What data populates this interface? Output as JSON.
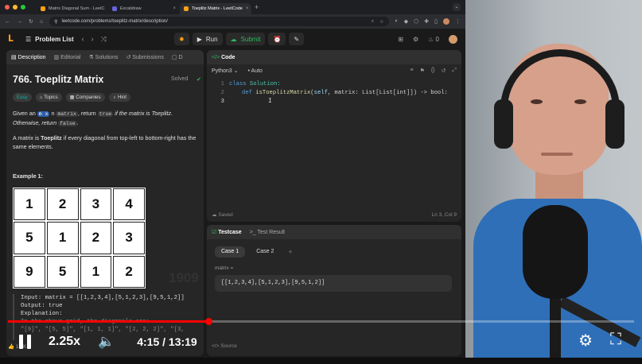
{
  "browser": {
    "tabs": [
      {
        "label": "Matrix Diagonal Sum - LeetC",
        "favicon_color": "#ffa116",
        "active": false
      },
      {
        "label": "Excalidraw",
        "favicon_color": "#6965db",
        "active": false
      },
      {
        "label": "Toeplitz Matrix - LeetCode",
        "favicon_color": "#ffa116",
        "active": true
      }
    ],
    "url": "leetcode.com/problems/toeplitz-matrix/description/"
  },
  "nav": {
    "problem_list": "Problem List",
    "run": "Run",
    "submit": "Submit",
    "streak": "0"
  },
  "left_tabs": [
    "Description",
    "Editorial",
    "Solutions",
    "Submissions",
    "D"
  ],
  "problem": {
    "title": "766. Toeplitz Matrix",
    "solved": "Solved",
    "difficulty": "Easy",
    "chips": [
      "Topics",
      "Companies",
      "Hint"
    ],
    "para1_a": "Given an",
    "para1_m": "m x",
    "para1_n": "n",
    "para1_matrix": "matrix",
    "para1_b": ", return",
    "para1_true": "true",
    "para1_c": "if the matrix is Toeplitz.",
    "para1_d": "Otherwise, return",
    "para1_false": "false",
    "para2_a": "A matrix is",
    "para2_bold": "Toeplitz",
    "para2_b": "if every diagonal from top-left to bottom-right has the same elements.",
    "example_title": "Example 1:",
    "grid": [
      "1",
      "2",
      "3",
      "4",
      "5",
      "1",
      "2",
      "3",
      "9",
      "5",
      "1",
      "2"
    ],
    "example_input": "Input: matrix = [[1,2,3,4],[5,1,2,3],[9,5,1,2]]",
    "example_output": "Output: true",
    "example_expl": "Explanation:",
    "example_more1": "In the above grid, the diagonals are:",
    "example_more2": "\"[9]\", \"[5, 5]\", \"[1, 1, 1]\", \"[2, 2, 2]\", \"[3,",
    "likes": "1.9K"
  },
  "code_panel": {
    "title": "Code",
    "language": "Python3",
    "mode": "Auto",
    "line_numbers": [
      "1",
      "2",
      "3"
    ],
    "line1_kw": "class",
    "line1_name": "Solution:",
    "line2_kw": "def",
    "line2_fn": "isToeplitzMatrix",
    "line2_self": "self",
    "line2_rest": ", matrix: List[List[int]]) -> bool:",
    "saved": "Saved",
    "position": "Ln 3, Col 9"
  },
  "test_panel": {
    "tab_testcase": "Testcase",
    "tab_result": "Test Result",
    "cases": [
      "Case 1",
      "Case 2"
    ],
    "plus": "+",
    "var_label": "matrix =",
    "var_value": "[[1,2,3,4],[5,1,2,3],[9,5,1,2]]",
    "source": "Source"
  },
  "watermark": "1909",
  "video": {
    "speed": "2.25x",
    "time": "4:15 / 13:19",
    "progress": 0.32,
    "accent": "#ff0000"
  }
}
